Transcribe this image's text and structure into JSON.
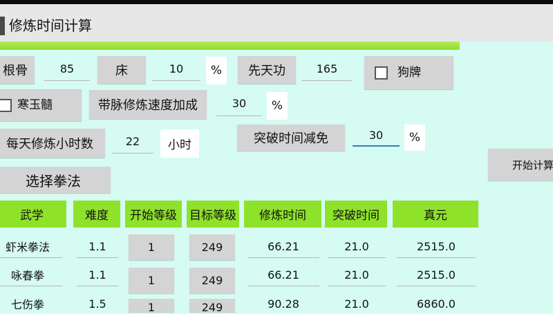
{
  "app": {
    "title": "修炼时间计算"
  },
  "params": {
    "root_label": "根骨",
    "root_value": "85",
    "bed_label": "床",
    "bed_value": "10",
    "bed_unit": "%",
    "innate_label": "先天功",
    "innate_value": "165",
    "dog_label": "狗牌",
    "jade_label": "寒玉髓",
    "meridian_label": "带脉修炼速度加成",
    "meridian_value": "30",
    "meridian_unit": "%",
    "hours_label": "每天修炼小时数",
    "hours_value": "22",
    "hours_unit": "小时",
    "breakthrough_label": "突破时间减免",
    "breakthrough_value": "30",
    "breakthrough_unit": "%"
  },
  "actions": {
    "start_label": "开始计算",
    "select_label": "选择拳法"
  },
  "table": {
    "headers": [
      "武学",
      "难度",
      "开始等级",
      "目标等级",
      "修炼时间",
      "突破时间",
      "真元"
    ],
    "rows": [
      {
        "name": "虾米拳法",
        "difficulty": "1.1",
        "start": "1",
        "target": "249",
        "train": "66.21",
        "break": "21.0",
        "zhenyuan": "2515.0"
      },
      {
        "name": "咏春拳",
        "difficulty": "1.1",
        "start": "1",
        "target": "249",
        "train": "66.21",
        "break": "21.0",
        "zhenyuan": "2515.0"
      },
      {
        "name": "七伤拳",
        "difficulty": "1.5",
        "start": "1",
        "target": "249",
        "train": "90.28",
        "break": "21.0",
        "zhenyuan": "6860.0"
      }
    ]
  },
  "colors": {
    "accent": "#8fe22a",
    "background": "#d6fbf3",
    "button": "#d4d4d4"
  }
}
